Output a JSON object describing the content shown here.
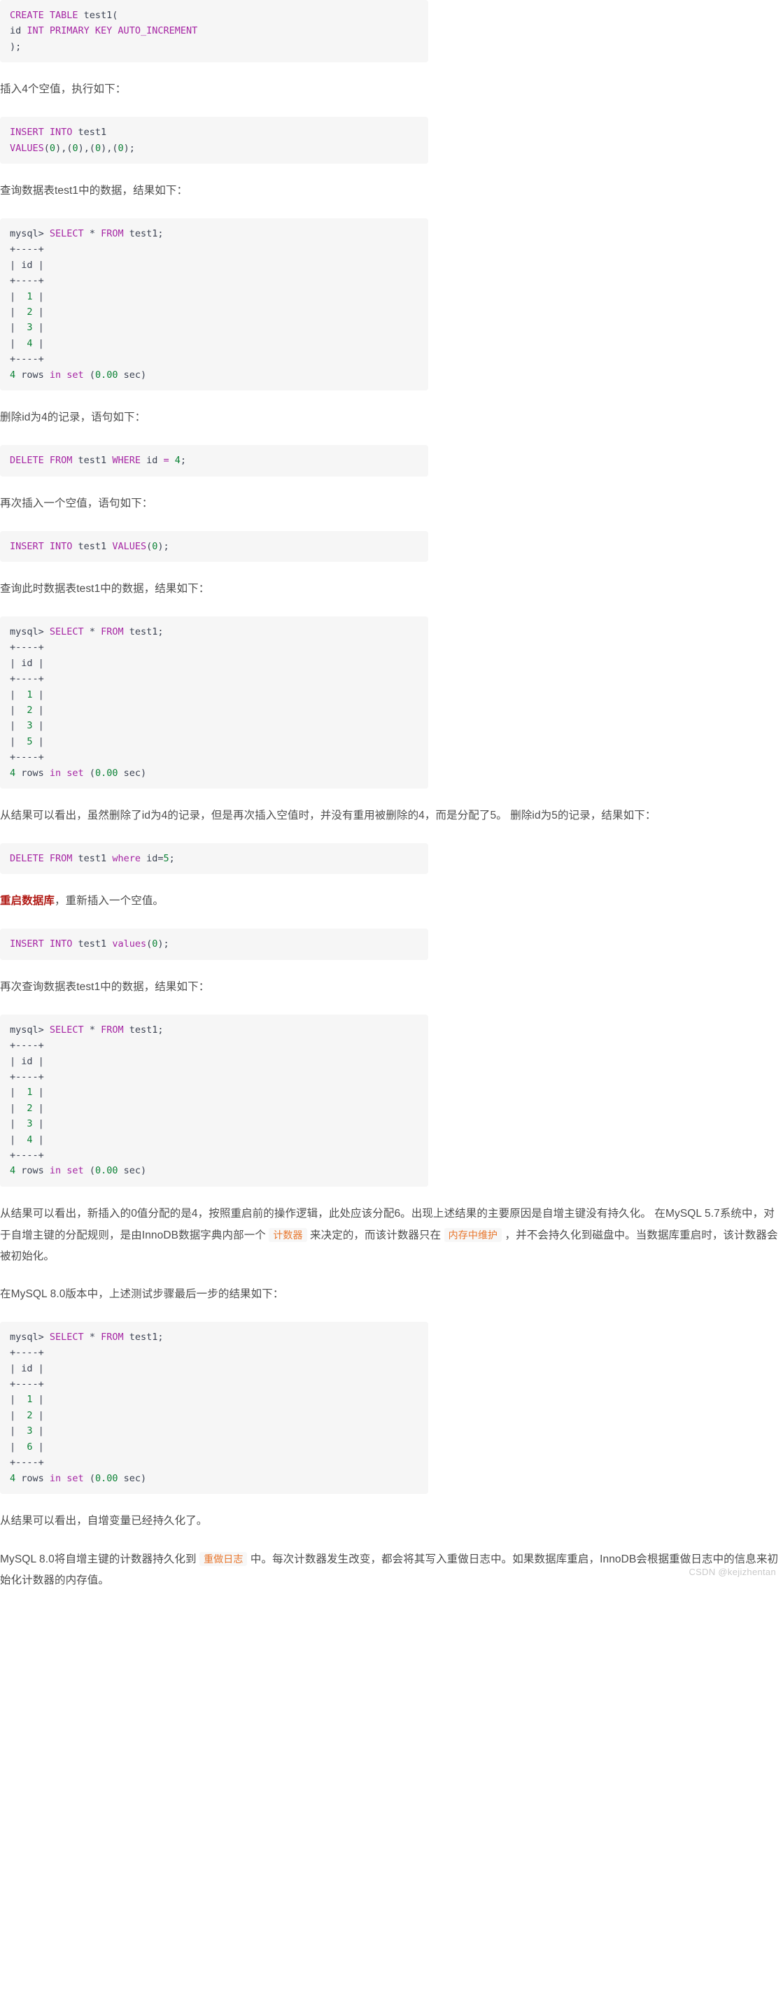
{
  "document": {
    "watermark": "CSDN @kejizhentan"
  },
  "blocks": [
    {
      "kind": "code",
      "name": "code-create-table",
      "lines": [
        [
          {
            "t": "CREATE TABLE ",
            "c": "kw"
          },
          {
            "t": "test1(",
            "c": "id"
          }
        ],
        [
          {
            "t": "id ",
            "c": "id"
          },
          {
            "t": "INT PRIMARY KEY AUTO_INCREMENT",
            "c": "kw"
          }
        ],
        [
          {
            "t": ");",
            "c": "id"
          }
        ]
      ]
    },
    {
      "kind": "para",
      "name": "para-insert-four-nulls",
      "runs": [
        {
          "t": "插入4个空值，执行如下：",
          "c": ""
        }
      ]
    },
    {
      "kind": "code",
      "name": "code-insert-four",
      "lines": [
        [
          {
            "t": "INSERT INTO ",
            "c": "kw"
          },
          {
            "t": "test1",
            "c": "id"
          }
        ],
        [
          {
            "t": "VALUES",
            "c": "kw"
          },
          {
            "t": "(",
            "c": "id"
          },
          {
            "t": "0",
            "c": "num"
          },
          {
            "t": "),(",
            "c": "id"
          },
          {
            "t": "0",
            "c": "num"
          },
          {
            "t": "),(",
            "c": "id"
          },
          {
            "t": "0",
            "c": "num"
          },
          {
            "t": "),(",
            "c": "id"
          },
          {
            "t": "0",
            "c": "num"
          },
          {
            "t": ");",
            "c": "id"
          }
        ]
      ]
    },
    {
      "kind": "para",
      "name": "para-query-test1-data",
      "runs": [
        {
          "t": "查询数据表test1中的数据，结果如下：",
          "c": ""
        }
      ]
    },
    {
      "kind": "code",
      "name": "code-select-result-1",
      "lines": [
        [
          {
            "t": "mysql> ",
            "c": "id"
          },
          {
            "t": "SELECT ",
            "c": "kw"
          },
          {
            "t": "* ",
            "c": "id"
          },
          {
            "t": "FROM ",
            "c": "kw"
          },
          {
            "t": "test1;",
            "c": "id"
          }
        ],
        [
          {
            "t": "+----+",
            "c": "id"
          }
        ],
        [
          {
            "t": "| id |",
            "c": "id"
          }
        ],
        [
          {
            "t": "+----+",
            "c": "id"
          }
        ],
        [
          {
            "t": "|  ",
            "c": "id"
          },
          {
            "t": "1",
            "c": "num"
          },
          {
            "t": " |",
            "c": "id"
          }
        ],
        [
          {
            "t": "|  ",
            "c": "id"
          },
          {
            "t": "2",
            "c": "num"
          },
          {
            "t": " |",
            "c": "id"
          }
        ],
        [
          {
            "t": "|  ",
            "c": "id"
          },
          {
            "t": "3",
            "c": "num"
          },
          {
            "t": " |",
            "c": "id"
          }
        ],
        [
          {
            "t": "|  ",
            "c": "id"
          },
          {
            "t": "4",
            "c": "num"
          },
          {
            "t": " |",
            "c": "id"
          }
        ],
        [
          {
            "t": "+----+",
            "c": "id"
          }
        ],
        [
          {
            "t": "4",
            "c": "num"
          },
          {
            "t": " rows ",
            "c": "id"
          },
          {
            "t": "in set ",
            "c": "kw"
          },
          {
            "t": "(",
            "c": "id"
          },
          {
            "t": "0.00",
            "c": "num"
          },
          {
            "t": " sec)",
            "c": "id"
          }
        ]
      ]
    },
    {
      "kind": "para",
      "name": "para-delete-id-4",
      "runs": [
        {
          "t": "删除id为4的记录，语句如下：",
          "c": ""
        }
      ]
    },
    {
      "kind": "code",
      "name": "code-delete-where-id-4",
      "lines": [
        [
          {
            "t": "DELETE FROM ",
            "c": "kw"
          },
          {
            "t": "test1 ",
            "c": "id"
          },
          {
            "t": "WHERE ",
            "c": "kw"
          },
          {
            "t": "id ",
            "c": "id"
          },
          {
            "t": "= ",
            "c": "kw"
          },
          {
            "t": "4",
            "c": "num"
          },
          {
            "t": ";",
            "c": "id"
          }
        ]
      ]
    },
    {
      "kind": "para",
      "name": "para-insert-one-null-again",
      "runs": [
        {
          "t": "再次插入一个空值，语句如下：",
          "c": ""
        }
      ]
    },
    {
      "kind": "code",
      "name": "code-insert-values-zero",
      "lines": [
        [
          {
            "t": "INSERT INTO ",
            "c": "kw"
          },
          {
            "t": "test1 ",
            "c": "id"
          },
          {
            "t": "VALUES",
            "c": "kw"
          },
          {
            "t": "(",
            "c": "id"
          },
          {
            "t": "0",
            "c": "num"
          },
          {
            "t": ");",
            "c": "id"
          }
        ]
      ]
    },
    {
      "kind": "para",
      "name": "para-query-now",
      "runs": [
        {
          "t": "查询此时数据表test1中的数据，结果如下：",
          "c": ""
        }
      ]
    },
    {
      "kind": "code",
      "name": "code-select-result-2",
      "lines": [
        [
          {
            "t": "mysql> ",
            "c": "id"
          },
          {
            "t": "SELECT ",
            "c": "kw"
          },
          {
            "t": "* ",
            "c": "id"
          },
          {
            "t": "FROM ",
            "c": "kw"
          },
          {
            "t": "test1;",
            "c": "id"
          }
        ],
        [
          {
            "t": "+----+",
            "c": "id"
          }
        ],
        [
          {
            "t": "| id |",
            "c": "id"
          }
        ],
        [
          {
            "t": "+----+",
            "c": "id"
          }
        ],
        [
          {
            "t": "|  ",
            "c": "id"
          },
          {
            "t": "1",
            "c": "num"
          },
          {
            "t": " |",
            "c": "id"
          }
        ],
        [
          {
            "t": "|  ",
            "c": "id"
          },
          {
            "t": "2",
            "c": "num"
          },
          {
            "t": " |",
            "c": "id"
          }
        ],
        [
          {
            "t": "|  ",
            "c": "id"
          },
          {
            "t": "3",
            "c": "num"
          },
          {
            "t": " |",
            "c": "id"
          }
        ],
        [
          {
            "t": "|  ",
            "c": "id"
          },
          {
            "t": "5",
            "c": "num"
          },
          {
            "t": " |",
            "c": "id"
          }
        ],
        [
          {
            "t": "+----+",
            "c": "id"
          }
        ],
        [
          {
            "t": "4",
            "c": "num"
          },
          {
            "t": " rows ",
            "c": "id"
          },
          {
            "t": "in set ",
            "c": "kw"
          },
          {
            "t": "(",
            "c": "id"
          },
          {
            "t": "0.00",
            "c": "num"
          },
          {
            "t": " sec)",
            "c": "id"
          }
        ]
      ]
    },
    {
      "kind": "para",
      "name": "para-analysis-1",
      "runs": [
        {
          "t": "从结果可以看出，虽然删除了id为4的记录，但是再次插入空值时，并没有重用被删除的4，而是分配了5。 删除id为5的记录，结果如下：",
          "c": ""
        }
      ]
    },
    {
      "kind": "code",
      "name": "code-delete-where-id-5",
      "lines": [
        [
          {
            "t": "DELETE FROM ",
            "c": "kw"
          },
          {
            "t": "test1 ",
            "c": "id"
          },
          {
            "t": "where ",
            "c": "kw"
          },
          {
            "t": "id=",
            "c": "id"
          },
          {
            "t": "5",
            "c": "num"
          },
          {
            "t": ";",
            "c": "id"
          }
        ]
      ]
    },
    {
      "kind": "para",
      "name": "para-restart-db",
      "runs": [
        {
          "t": "重启数据库",
          "c": "hl-red"
        },
        {
          "t": "，重新插入一个空值。",
          "c": ""
        }
      ]
    },
    {
      "kind": "code",
      "name": "code-insert-values-zero-2",
      "lines": [
        [
          {
            "t": "INSERT INTO ",
            "c": "kw"
          },
          {
            "t": "test1 ",
            "c": "id"
          },
          {
            "t": "values",
            "c": "kw"
          },
          {
            "t": "(",
            "c": "id"
          },
          {
            "t": "0",
            "c": "num"
          },
          {
            "t": ");",
            "c": "id"
          }
        ]
      ]
    },
    {
      "kind": "para",
      "name": "para-query-again",
      "runs": [
        {
          "t": "再次查询数据表test1中的数据，结果如下：",
          "c": ""
        }
      ]
    },
    {
      "kind": "code",
      "name": "code-select-result-3",
      "lines": [
        [
          {
            "t": "mysql> ",
            "c": "id"
          },
          {
            "t": "SELECT ",
            "c": "kw"
          },
          {
            "t": "* ",
            "c": "id"
          },
          {
            "t": "FROM ",
            "c": "kw"
          },
          {
            "t": "test1;",
            "c": "id"
          }
        ],
        [
          {
            "t": "+----+",
            "c": "id"
          }
        ],
        [
          {
            "t": "| id |",
            "c": "id"
          }
        ],
        [
          {
            "t": "+----+",
            "c": "id"
          }
        ],
        [
          {
            "t": "|  ",
            "c": "id"
          },
          {
            "t": "1",
            "c": "num"
          },
          {
            "t": " |",
            "c": "id"
          }
        ],
        [
          {
            "t": "|  ",
            "c": "id"
          },
          {
            "t": "2",
            "c": "num"
          },
          {
            "t": " |",
            "c": "id"
          }
        ],
        [
          {
            "t": "|  ",
            "c": "id"
          },
          {
            "t": "3",
            "c": "num"
          },
          {
            "t": " |",
            "c": "id"
          }
        ],
        [
          {
            "t": "|  ",
            "c": "id"
          },
          {
            "t": "4",
            "c": "num"
          },
          {
            "t": " |",
            "c": "id"
          }
        ],
        [
          {
            "t": "+----+",
            "c": "id"
          }
        ],
        [
          {
            "t": "4",
            "c": "num"
          },
          {
            "t": " rows ",
            "c": "id"
          },
          {
            "t": "in set ",
            "c": "kw"
          },
          {
            "t": "(",
            "c": "id"
          },
          {
            "t": "0.00",
            "c": "num"
          },
          {
            "t": " sec)",
            "c": "id"
          }
        ]
      ]
    },
    {
      "kind": "para",
      "name": "para-analysis-2",
      "runs": [
        {
          "t": "从结果可以看出，新插入的0值分配的是4，按照重启前的操作逻辑，此处应该分配6。出现上述结果的主要原因是自增主键没有持久化。 在MySQL 5.7系统中，对于自增主键的分配规则，是由InnoDB数据字典内部一个 ",
          "c": ""
        },
        {
          "t": "计数器",
          "c": "inline"
        },
        {
          "t": " 来决定的，而该计数器只在 ",
          "c": ""
        },
        {
          "t": "内存中维护",
          "c": "inline"
        },
        {
          "t": " ，并不会持久化到磁盘中。当数据库重启时，该计数器会被初始化。",
          "c": ""
        }
      ]
    },
    {
      "kind": "para",
      "name": "para-mysql8-intro",
      "runs": [
        {
          "t": "在MySQL 8.0版本中，上述测试步骤最后一步的结果如下：",
          "c": ""
        }
      ]
    },
    {
      "kind": "code",
      "name": "code-select-result-4",
      "lines": [
        [
          {
            "t": "mysql> ",
            "c": "id"
          },
          {
            "t": "SELECT ",
            "c": "kw"
          },
          {
            "t": "* ",
            "c": "id"
          },
          {
            "t": "FROM ",
            "c": "kw"
          },
          {
            "t": "test1;",
            "c": "id"
          }
        ],
        [
          {
            "t": "+----+",
            "c": "id"
          }
        ],
        [
          {
            "t": "| id |",
            "c": "id"
          }
        ],
        [
          {
            "t": "+----+",
            "c": "id"
          }
        ],
        [
          {
            "t": "|  ",
            "c": "id"
          },
          {
            "t": "1",
            "c": "num"
          },
          {
            "t": " |",
            "c": "id"
          }
        ],
        [
          {
            "t": "|  ",
            "c": "id"
          },
          {
            "t": "2",
            "c": "num"
          },
          {
            "t": " |",
            "c": "id"
          }
        ],
        [
          {
            "t": "|  ",
            "c": "id"
          },
          {
            "t": "3",
            "c": "num"
          },
          {
            "t": " |",
            "c": "id"
          }
        ],
        [
          {
            "t": "|  ",
            "c": "id"
          },
          {
            "t": "6",
            "c": "num"
          },
          {
            "t": " |",
            "c": "id"
          }
        ],
        [
          {
            "t": "+----+",
            "c": "id"
          }
        ],
        [
          {
            "t": "4",
            "c": "num"
          },
          {
            "t": " rows ",
            "c": "id"
          },
          {
            "t": "in set ",
            "c": "kw"
          },
          {
            "t": "(",
            "c": "id"
          },
          {
            "t": "0.00",
            "c": "num"
          },
          {
            "t": " sec)",
            "c": "id"
          }
        ]
      ]
    },
    {
      "kind": "para",
      "name": "para-conclusion",
      "runs": [
        {
          "t": "从结果可以看出，自增变量已经持久化了。",
          "c": ""
        }
      ]
    },
    {
      "kind": "para",
      "name": "para-mysql8-redo-log",
      "runs": [
        {
          "t": "MySQL 8.0将自增主键的计数器持久化到 ",
          "c": ""
        },
        {
          "t": "重做日志",
          "c": "inline"
        },
        {
          "t": " 中。每次计数器发生改变，都会将其写入重做日志中。如果数据库重启，InnoDB会根据重做日志中的信息来初始化计数器的内存值。",
          "c": ""
        }
      ]
    }
  ]
}
